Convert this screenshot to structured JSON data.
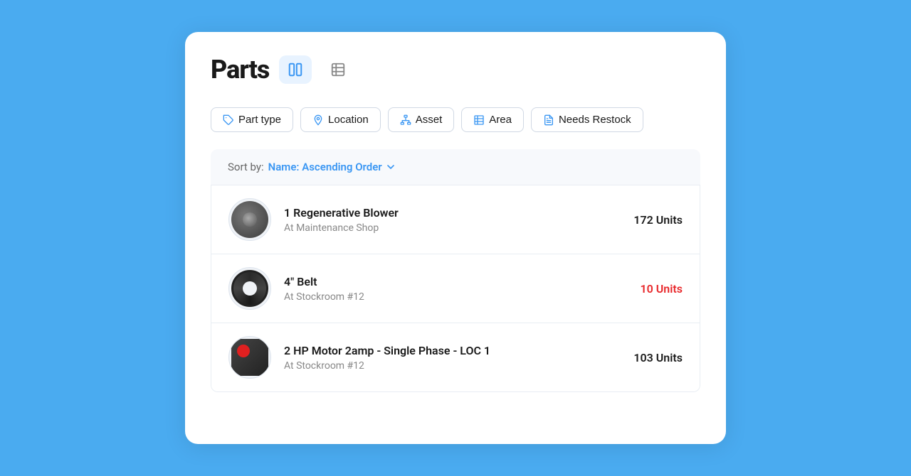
{
  "page": {
    "title": "Parts",
    "views": [
      {
        "id": "columns",
        "label": "Columns view",
        "active": true
      },
      {
        "id": "table",
        "label": "Table view",
        "active": false
      }
    ],
    "filters": [
      {
        "id": "part-type",
        "label": "Part type",
        "icon": "tag"
      },
      {
        "id": "location",
        "label": "Location",
        "icon": "location-pin"
      },
      {
        "id": "asset",
        "label": "Asset",
        "icon": "hierarchy"
      },
      {
        "id": "area",
        "label": "Area",
        "icon": "building"
      },
      {
        "id": "needs-restock",
        "label": "Needs Restock",
        "icon": "restock"
      }
    ],
    "sort": {
      "label": "Sort by:",
      "value": "Name: Ascending Order"
    },
    "parts": [
      {
        "id": "blower",
        "name": "1 Regenerative Blower",
        "location": "At Maintenance Shop",
        "units": "172 Units",
        "low": false
      },
      {
        "id": "belt",
        "name": "4\" Belt",
        "location": "At Stockroom #12",
        "units": "10 Units",
        "low": true
      },
      {
        "id": "motor",
        "name": "2 HP Motor 2amp - Single Phase - LOC 1",
        "location": "At Stockroom #12",
        "units": "103 Units",
        "low": false
      }
    ]
  }
}
